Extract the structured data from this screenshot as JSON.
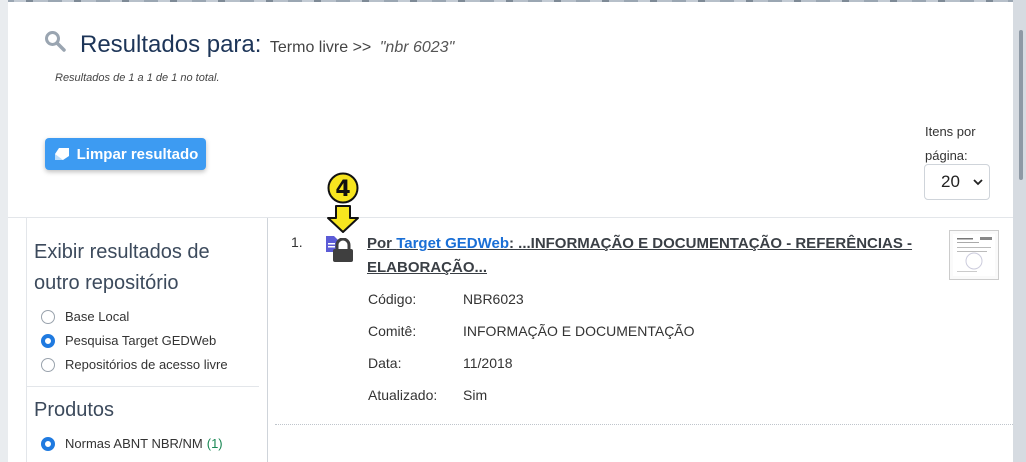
{
  "header": {
    "title": "Resultados para:",
    "crumb": "Termo livre >>",
    "query": "\"nbr 6023\"",
    "results_count": "Resultados de 1 a 1 de 1 no total."
  },
  "toolbar": {
    "clear_label": "Limpar resultado",
    "per_page_label_1": "Itens por",
    "per_page_label_2": "página:",
    "per_page_value": "20"
  },
  "sidebar": {
    "repo_heading_1": "Exibir resultados de",
    "repo_heading_2": "outro repositório",
    "repo_options": [
      {
        "label": "Base Local",
        "selected": false
      },
      {
        "label": "Pesquisa Target GEDWeb",
        "selected": true
      },
      {
        "label": "Repositórios de acesso livre",
        "selected": false
      }
    ],
    "products_heading": "Produtos",
    "products": [
      {
        "label": "Normas ABNT NBR/NM",
        "count": "(1)",
        "selected": true
      }
    ]
  },
  "result": {
    "number": "1.",
    "badge": "4",
    "title_prefix": "Por",
    "title_link": "Target GEDWeb",
    "title_line1": ": ...INFORMAÇÃO E DOCUMENTAÇÃO - REFERÊNCIAS -",
    "title_line2": "ELABORAÇÃO...",
    "meta": [
      {
        "label": "Código:",
        "value": "NBR6023"
      },
      {
        "label": "Comitê:",
        "value": "INFORMAÇÃO E DOCUMENTAÇÃO"
      },
      {
        "label": "Data:",
        "value": "11/2018"
      },
      {
        "label": "Atualizado:",
        "value": "Sim"
      }
    ]
  },
  "colors": {
    "accent": "#3d9bf2",
    "link": "#1a6fd6",
    "title": "#1d3558",
    "badge_fill": "#f7e51f",
    "count_green": "#198754"
  },
  "icons": [
    "search-icon",
    "eraser-icon",
    "chevron-down-icon",
    "document-icon",
    "lock-icon",
    "badge-arrow-icon",
    "thumbnail-icon"
  ]
}
